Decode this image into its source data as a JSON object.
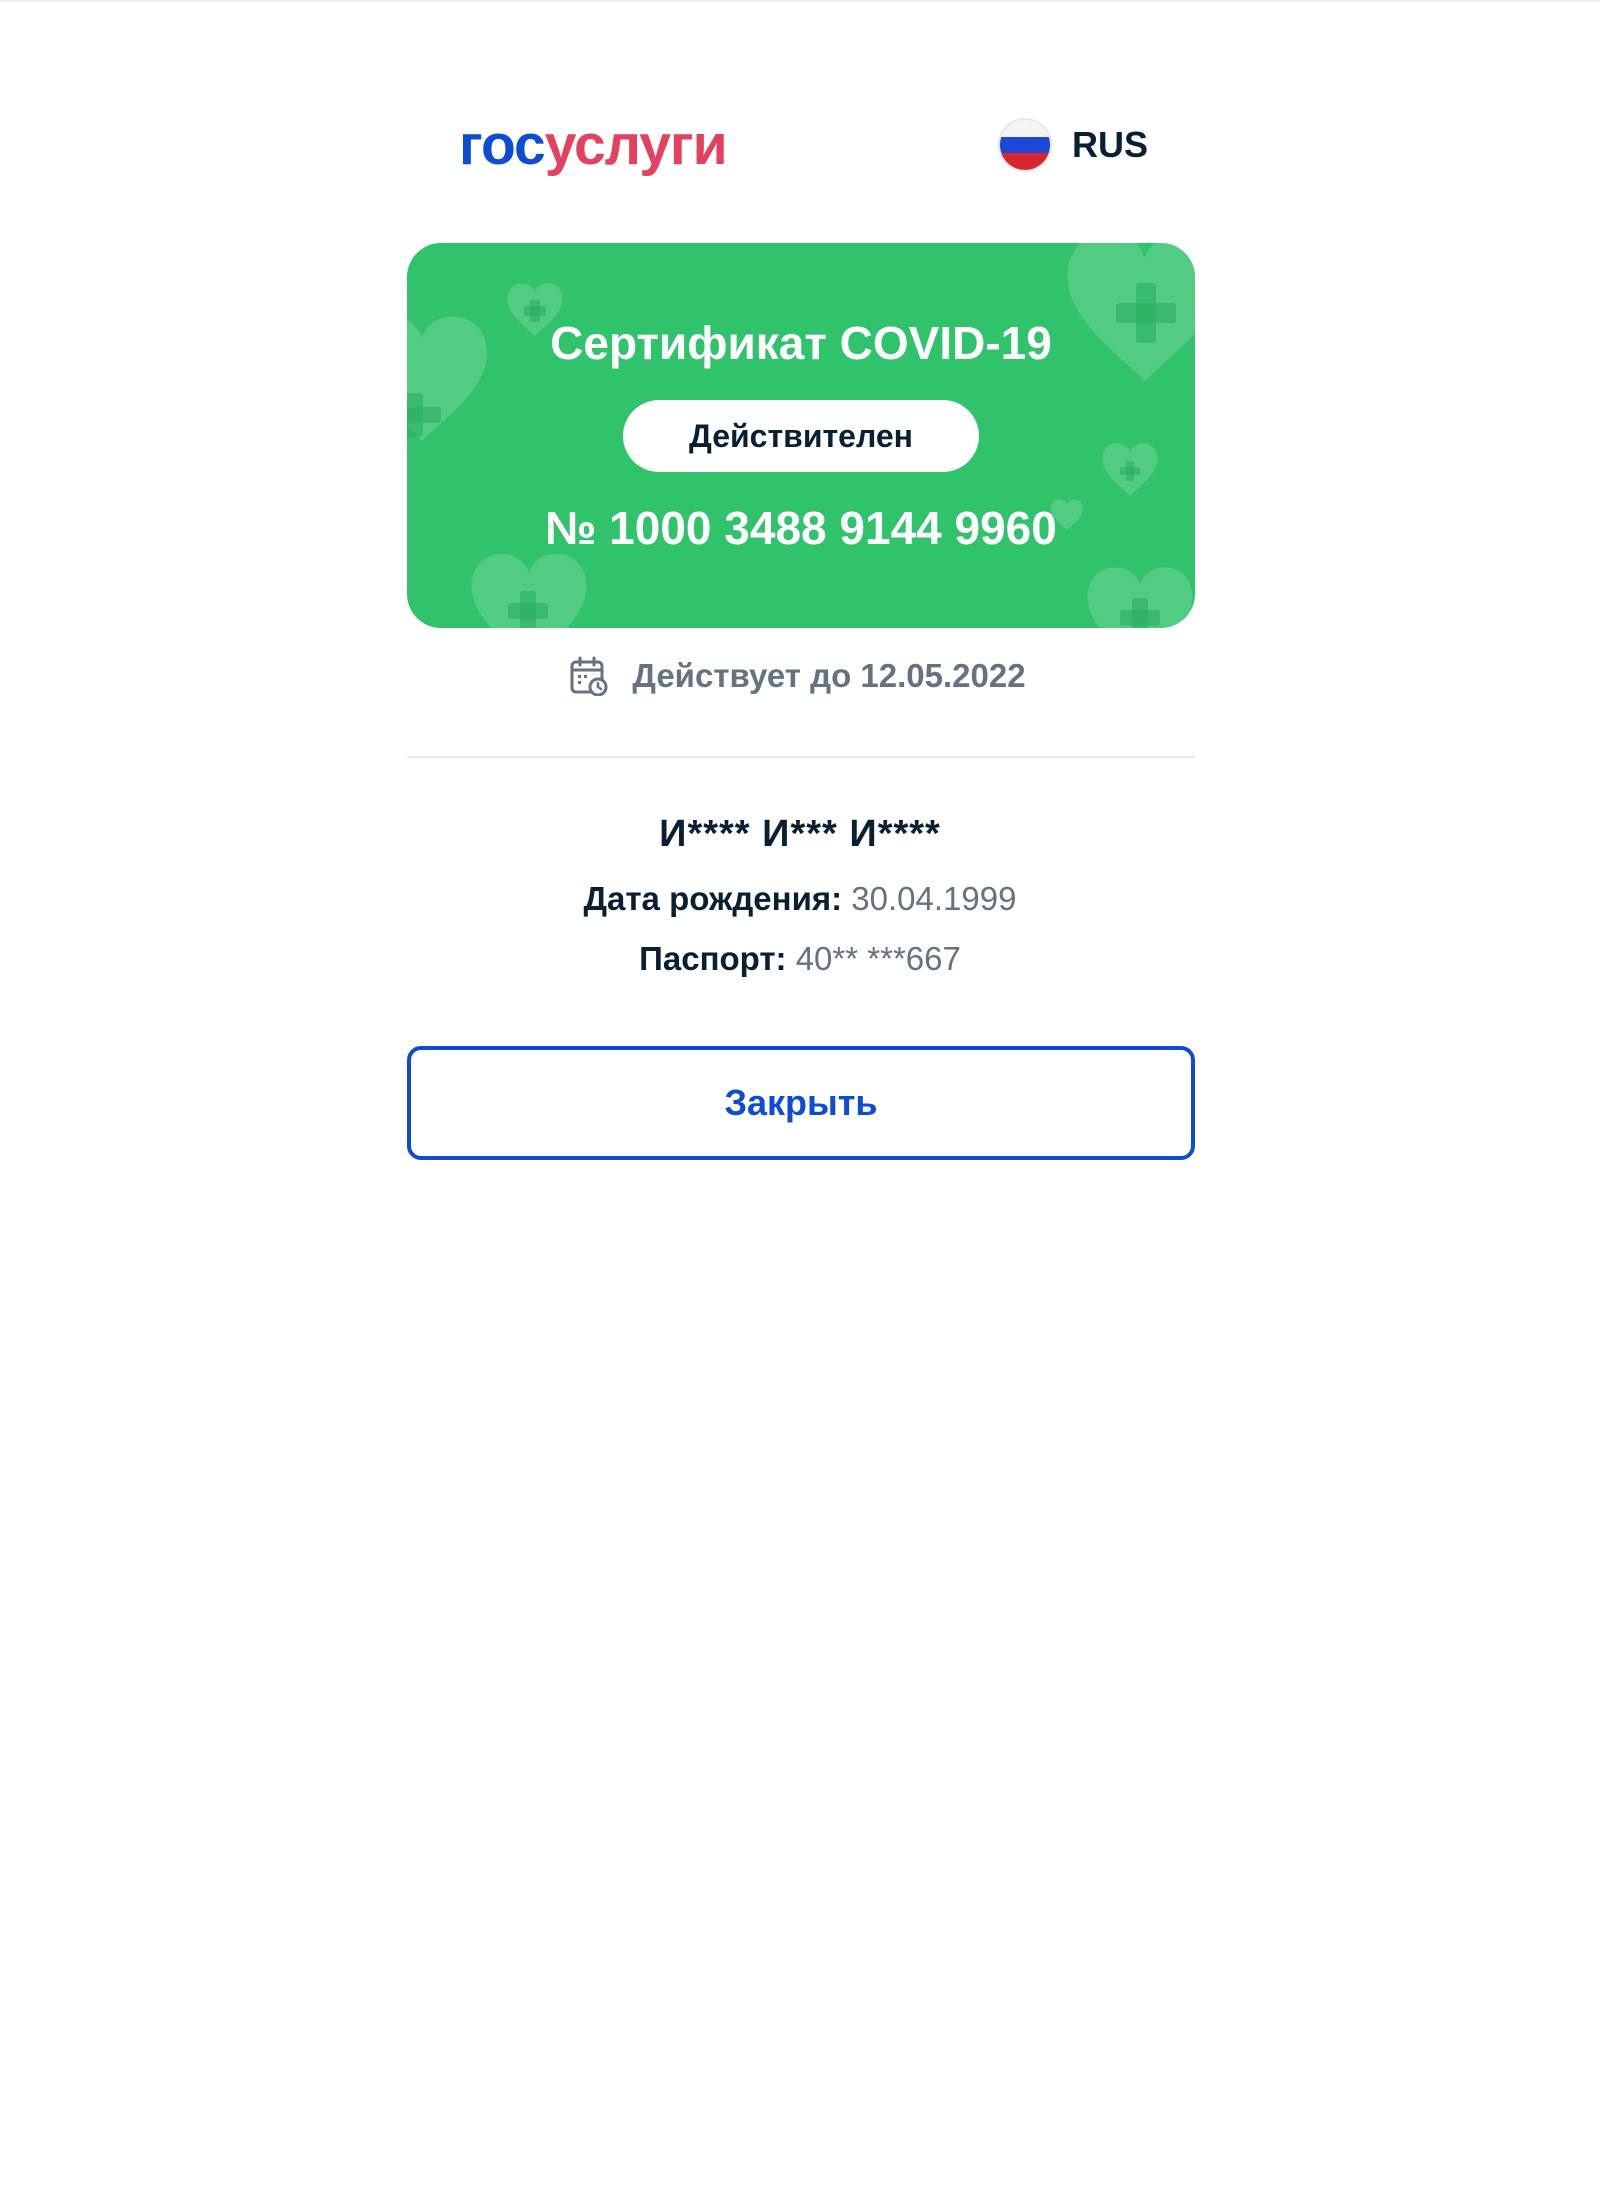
{
  "header": {
    "logo": {
      "part_a": "гос",
      "part_b": "услуги"
    },
    "language": {
      "label": "RUS",
      "flag_icon": "russia-flag-icon"
    }
  },
  "certificate": {
    "title": "Сертификат COVID-19",
    "status": "Действителен",
    "number": "№ 1000 3488 9144 9960",
    "card_color": "#31c26c"
  },
  "validity": {
    "icon": "calendar-clock-icon",
    "text": "Действует до 12.05.2022"
  },
  "person": {
    "name": "И**** И*** И****",
    "birth_label": "Дата рождения:",
    "birth_value": "30.04.1999",
    "passport_label": "Паспорт:",
    "passport_value": "40** ***667"
  },
  "actions": {
    "close_label": "Закрыть"
  },
  "colors": {
    "brand_blue": "#0d4cd3",
    "brand_red": "#e4405f",
    "muted_text": "#66727f",
    "primary_text": "#0b1f33"
  }
}
